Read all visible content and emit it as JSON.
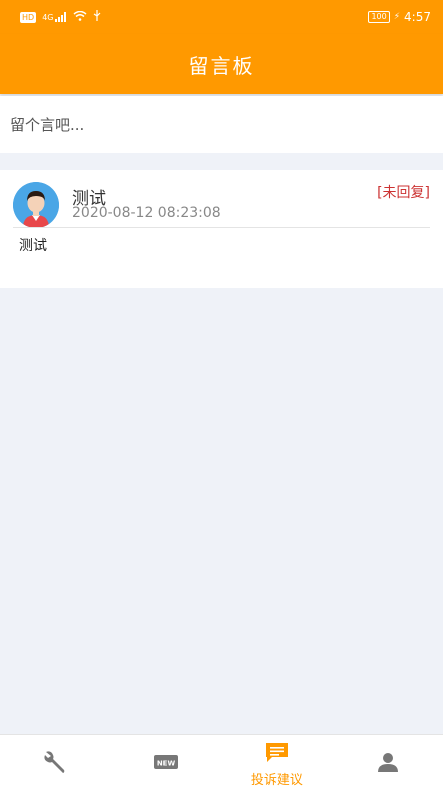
{
  "statusbar": {
    "hd": "HD",
    "signal": "4G",
    "battery": "100",
    "time": "4:57"
  },
  "appbar": {
    "title": "留言板"
  },
  "input": {
    "placeholder": "留个言吧..."
  },
  "message": {
    "user": "测试",
    "time": "2020-08-12 08:23:08",
    "status": "[未回复]",
    "content": "测试"
  },
  "tabs": [
    {
      "icon": "wrench-icon",
      "label": ""
    },
    {
      "icon": "new-icon",
      "label": ""
    },
    {
      "icon": "message-icon",
      "label": "投诉建议"
    },
    {
      "icon": "person-icon",
      "label": ""
    }
  ],
  "colors": {
    "accent": "#ff9900",
    "background": "#eff2f8",
    "status": "#cc3333"
  }
}
